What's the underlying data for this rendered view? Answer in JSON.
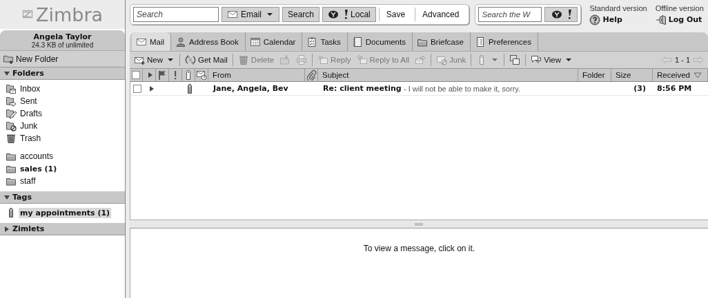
{
  "logo": {
    "text": "Zimbra"
  },
  "account": {
    "name": "Angela Taylor",
    "quota": "24.3 KB of unlimited"
  },
  "sidebar": {
    "new_folder": "New Folder",
    "sections": [
      {
        "title": "Folders",
        "expanded": true,
        "items": [
          {
            "label": "Inbox",
            "kind": "inbox",
            "unread": false,
            "selected": false
          },
          {
            "label": "Sent",
            "kind": "sent",
            "unread": false,
            "selected": false
          },
          {
            "label": "Drafts",
            "kind": "drafts",
            "unread": false,
            "selected": false
          },
          {
            "label": "Junk",
            "kind": "junk",
            "unread": false,
            "selected": false
          },
          {
            "label": "Trash",
            "kind": "trash",
            "unread": false,
            "selected": false
          },
          {
            "label": "accounts",
            "kind": "folder",
            "unread": false,
            "selected": false
          },
          {
            "label": "sales (1)",
            "kind": "folder",
            "unread": true,
            "selected": false
          },
          {
            "label": "staff",
            "kind": "folder",
            "unread": false,
            "selected": false
          }
        ]
      },
      {
        "title": "Tags",
        "expanded": true,
        "items": [
          {
            "label": "my appointments (1)",
            "kind": "tag",
            "unread": true,
            "selected": true
          }
        ]
      },
      {
        "title": "Zimlets",
        "expanded": false
      }
    ]
  },
  "search": {
    "placeholder": "Search",
    "type_button": "Email",
    "search_button": "Search",
    "local_button": "Local",
    "save_button": "Save",
    "advanced_button": "Advanced",
    "web_placeholder": "Search the W"
  },
  "links": {
    "standard": "Standard version",
    "offline": "Offline version",
    "help": "Help",
    "logout": "Log Out"
  },
  "tabs": [
    {
      "label": "Mail",
      "selected": true
    },
    {
      "label": "Address Book",
      "selected": false
    },
    {
      "label": "Calendar",
      "selected": false
    },
    {
      "label": "Tasks",
      "selected": false
    },
    {
      "label": "Documents",
      "selected": false
    },
    {
      "label": "Briefcase",
      "selected": false
    },
    {
      "label": "Preferences",
      "selected": false
    }
  ],
  "toolbar": {
    "groups": [
      [
        {
          "label": "New",
          "disabled": false,
          "dropdown": true
        }
      ],
      [
        {
          "label": "Get Mail",
          "disabled": false
        }
      ],
      [
        {
          "label": "Delete",
          "disabled": true
        },
        {
          "disabled": true
        },
        {
          "disabled": true
        }
      ],
      [
        {
          "label": "Reply",
          "disabled": true
        },
        {
          "label": "Reply to All",
          "disabled": true
        },
        {
          "disabled": true
        }
      ],
      [
        {
          "label": "Junk",
          "disabled": true
        }
      ],
      [
        {
          "disabled": true,
          "dropdown": true
        }
      ],
      [
        {
          "disabled": false
        }
      ],
      [
        {
          "label": "View",
          "disabled": false,
          "dropdown": true
        }
      ]
    ],
    "pager": {
      "text": "1 - 1",
      "prev_disabled": true,
      "next_disabled": true
    }
  },
  "list": {
    "select_all_checked": false,
    "columns": [
      {
        "label": "From",
        "sorted": false
      },
      {
        "label": "Subject",
        "sorted": false
      },
      {
        "label": "Folder",
        "sorted": false
      },
      {
        "label": "Size",
        "sorted": false
      },
      {
        "label": "Received",
        "sorted": true
      }
    ],
    "rows": [
      {
        "checked": false,
        "expanded": false,
        "tagged": true,
        "unread": true,
        "from": "Jane, Angela, Bev",
        "subject": "Re: client meeting",
        "fragment": "- I will not be able to make it, sorry.",
        "size": "(3)",
        "received": "8:56 PM"
      }
    ]
  },
  "reading_pane": {
    "message": "To view a message, click on it."
  }
}
